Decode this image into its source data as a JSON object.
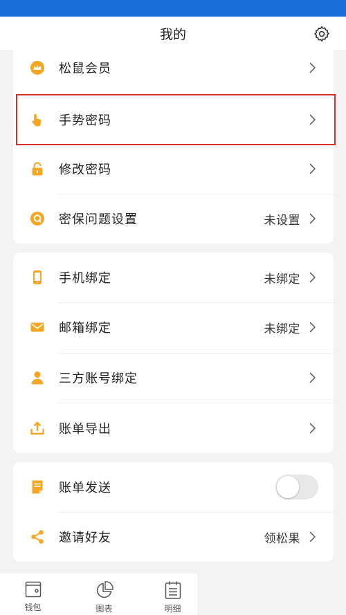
{
  "header": {
    "title": "我的"
  },
  "sections": [
    {
      "items": [
        {
          "label": "松鼠会员",
          "value": "",
          "icon": "crown-icon"
        },
        {
          "label": "手势密码",
          "value": "",
          "icon": "gesture-hand-icon"
        },
        {
          "label": "修改密码",
          "value": "",
          "icon": "lock-icon"
        },
        {
          "label": "密保问题设置",
          "value": "未设置",
          "icon": "security-question-icon"
        }
      ]
    },
    {
      "items": [
        {
          "label": "手机绑定",
          "value": "未绑定",
          "icon": "phone-icon"
        },
        {
          "label": "邮箱绑定",
          "value": "未绑定",
          "icon": "mail-icon"
        },
        {
          "label": "三方账号绑定",
          "value": "",
          "icon": "user-icon"
        },
        {
          "label": "账单导出",
          "value": "",
          "icon": "export-icon"
        }
      ]
    },
    {
      "items": [
        {
          "label": "账单发送",
          "value": "",
          "icon": "bill-send-icon",
          "toggle": false
        },
        {
          "label": "邀请好友",
          "value": "领松果",
          "icon": "share-icon"
        }
      ]
    }
  ],
  "tabbar": {
    "items": [
      {
        "label": "钱包",
        "icon": "wallet-icon"
      },
      {
        "label": "图表",
        "icon": "pie-chart-icon"
      },
      {
        "label": "明细",
        "icon": "detail-list-icon"
      }
    ]
  },
  "colors": {
    "accent": "#f5a623",
    "status_bar": "#1a6ed8",
    "highlight_border": "#d9302c"
  }
}
